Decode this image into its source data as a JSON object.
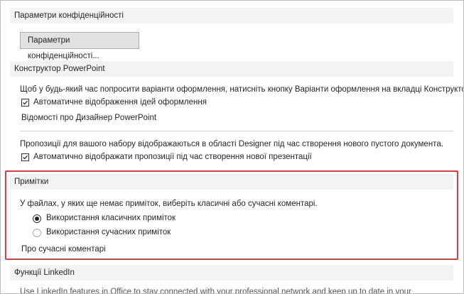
{
  "privacy": {
    "header": "Параметри конфіденційності",
    "button_label": "Параметри конфіденційності..."
  },
  "designer": {
    "header": "Конструктор PowerPoint",
    "description": "Щоб у будь-який час попросити варіанти оформлення, натисніть кнопку Варіанти оформлення на вкладці Конструктор.",
    "auto_show_label": "Автоматичне відображення ідей оформлення",
    "auto_show_checked": true,
    "about_link": "Відомості про Дизайнер PowerPoint",
    "suggestions_description": "Пропозиції для вашого набору відображаються в області Designer під час створення нового пустого документа.",
    "auto_suggest_label": "Автоматично відображати пропозиції під час створення нової презентації",
    "auto_suggest_checked": true
  },
  "comments": {
    "header": "Примітки",
    "description": "У файлах, у яких ще немає приміток, виберіть класичні або сучасні коментарі.",
    "option_classic": "Використання класичних приміток",
    "option_modern": "Використання сучасних приміток",
    "selected": "classic",
    "about_link": "Про сучасні коментарі"
  },
  "linkedin": {
    "header": "Функції LinkedIn",
    "description": "Use LinkedIn features in Office to stay connected with your professional network and keep up to date in your"
  },
  "colors": {
    "highlight_border": "#e0393e",
    "header_bg": "#f3f3f3"
  }
}
